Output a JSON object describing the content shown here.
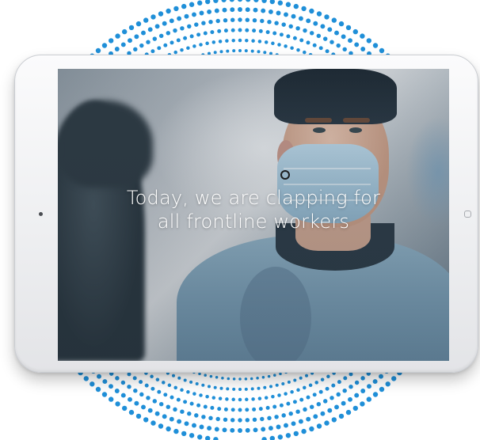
{
  "colors": {
    "dot_accent": "#1f8fd8",
    "device_frame": "#f2f3f5",
    "overlay_text": "#ffffff"
  },
  "screen": {
    "caption_line1": "Today, we are clapping for",
    "caption_line2": "all frontline workers"
  },
  "icons": [
    "front-camera-icon",
    "home-button-icon"
  ]
}
